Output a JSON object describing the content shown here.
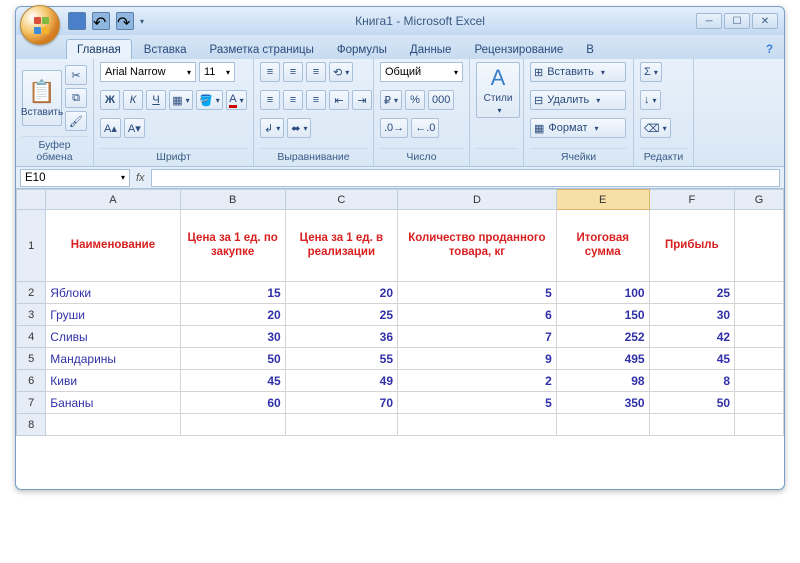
{
  "title": "Книга1 - Microsoft Excel",
  "qat": {
    "save": "save",
    "undo": "undo",
    "redo": "redo"
  },
  "tabs": [
    "Главная",
    "Вставка",
    "Разметка страницы",
    "Формулы",
    "Данные",
    "Рецензирование",
    "В"
  ],
  "activeTab": 0,
  "ribbon": {
    "clipboard": {
      "paste": "Вставить",
      "label": "Буфер обмена"
    },
    "font": {
      "name": "Arial Narrow",
      "size": "11",
      "bold": "Ж",
      "italic": "К",
      "underline": "Ч",
      "label": "Шрифт"
    },
    "alignment": {
      "label": "Выравнивание"
    },
    "number": {
      "format": "Общий",
      "label": "Число"
    },
    "styles": {
      "btn": "Стили"
    },
    "cells": {
      "insert": "Вставить",
      "delete": "Удалить",
      "format": "Формат",
      "label": "Ячейки"
    },
    "editing": {
      "label": "Редакти"
    }
  },
  "namebox": "E10",
  "columns": [
    "A",
    "B",
    "C",
    "D",
    "E",
    "F",
    "G"
  ],
  "selectedColumn": "E",
  "headerRow": {
    "A": "Наименование",
    "B": "Цена за 1 ед. по закупке",
    "C": "Цена за 1 ед. в реализации",
    "D": "Количество проданного товара, кг",
    "E": "Итоговая сумма",
    "F": "Прибыль"
  },
  "rows": [
    {
      "n": "2",
      "A": "Яблоки",
      "B": "15",
      "C": "20",
      "D": "5",
      "E": "100",
      "F": "25"
    },
    {
      "n": "3",
      "A": "Груши",
      "B": "20",
      "C": "25",
      "D": "6",
      "E": "150",
      "F": "30"
    },
    {
      "n": "4",
      "A": "Сливы",
      "B": "30",
      "C": "36",
      "D": "7",
      "E": "252",
      "F": "42"
    },
    {
      "n": "5",
      "A": "Мандарины",
      "B": "50",
      "C": "55",
      "D": "9",
      "E": "495",
      "F": "45"
    },
    {
      "n": "6",
      "A": "Киви",
      "B": "45",
      "C": "49",
      "D": "2",
      "E": "98",
      "F": "8"
    },
    {
      "n": "7",
      "A": "Бананы",
      "B": "60",
      "C": "70",
      "D": "5",
      "E": "350",
      "F": "50"
    }
  ],
  "emptyRow": "8"
}
